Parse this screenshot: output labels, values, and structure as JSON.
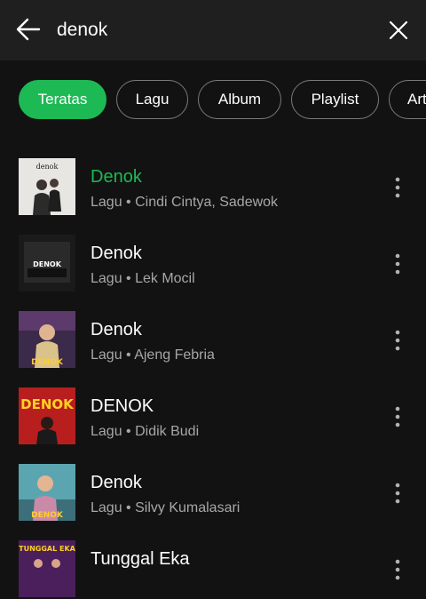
{
  "header": {
    "query": "denok",
    "back_icon": "arrow-left-icon",
    "clear_icon": "close-icon"
  },
  "filters": [
    {
      "label": "Teratas",
      "active": true
    },
    {
      "label": "Lagu",
      "active": false
    },
    {
      "label": "Album",
      "active": false
    },
    {
      "label": "Playlist",
      "active": false
    },
    {
      "label": "Artis",
      "active": false
    }
  ],
  "results": [
    {
      "title": "Denok",
      "subtitle": "Lagu • Cindi Cintya, Sadewok",
      "playing": true
    },
    {
      "title": "Denok",
      "subtitle": "Lagu • Lek Mocil",
      "playing": false
    },
    {
      "title": "Denok",
      "subtitle": "Lagu • Ajeng Febria",
      "playing": false
    },
    {
      "title": "DENOK",
      "subtitle": "Lagu • Didik Budi",
      "playing": false
    },
    {
      "title": "Denok",
      "subtitle": "Lagu • Silvy Kumalasari",
      "playing": false
    },
    {
      "title": "Tunggal Eka",
      "subtitle": "",
      "playing": false
    }
  ],
  "thumbs": {
    "t1": "denok",
    "t2": "DENOK",
    "t3": "DENOK",
    "t4": "DENOK",
    "t5": "DENOK",
    "t6": "TUNGGAL EKA"
  },
  "colors": {
    "accent": "#1db954",
    "background": "#121212",
    "header": "#1f1f1f",
    "secondary_text": "#a7a7a7"
  }
}
